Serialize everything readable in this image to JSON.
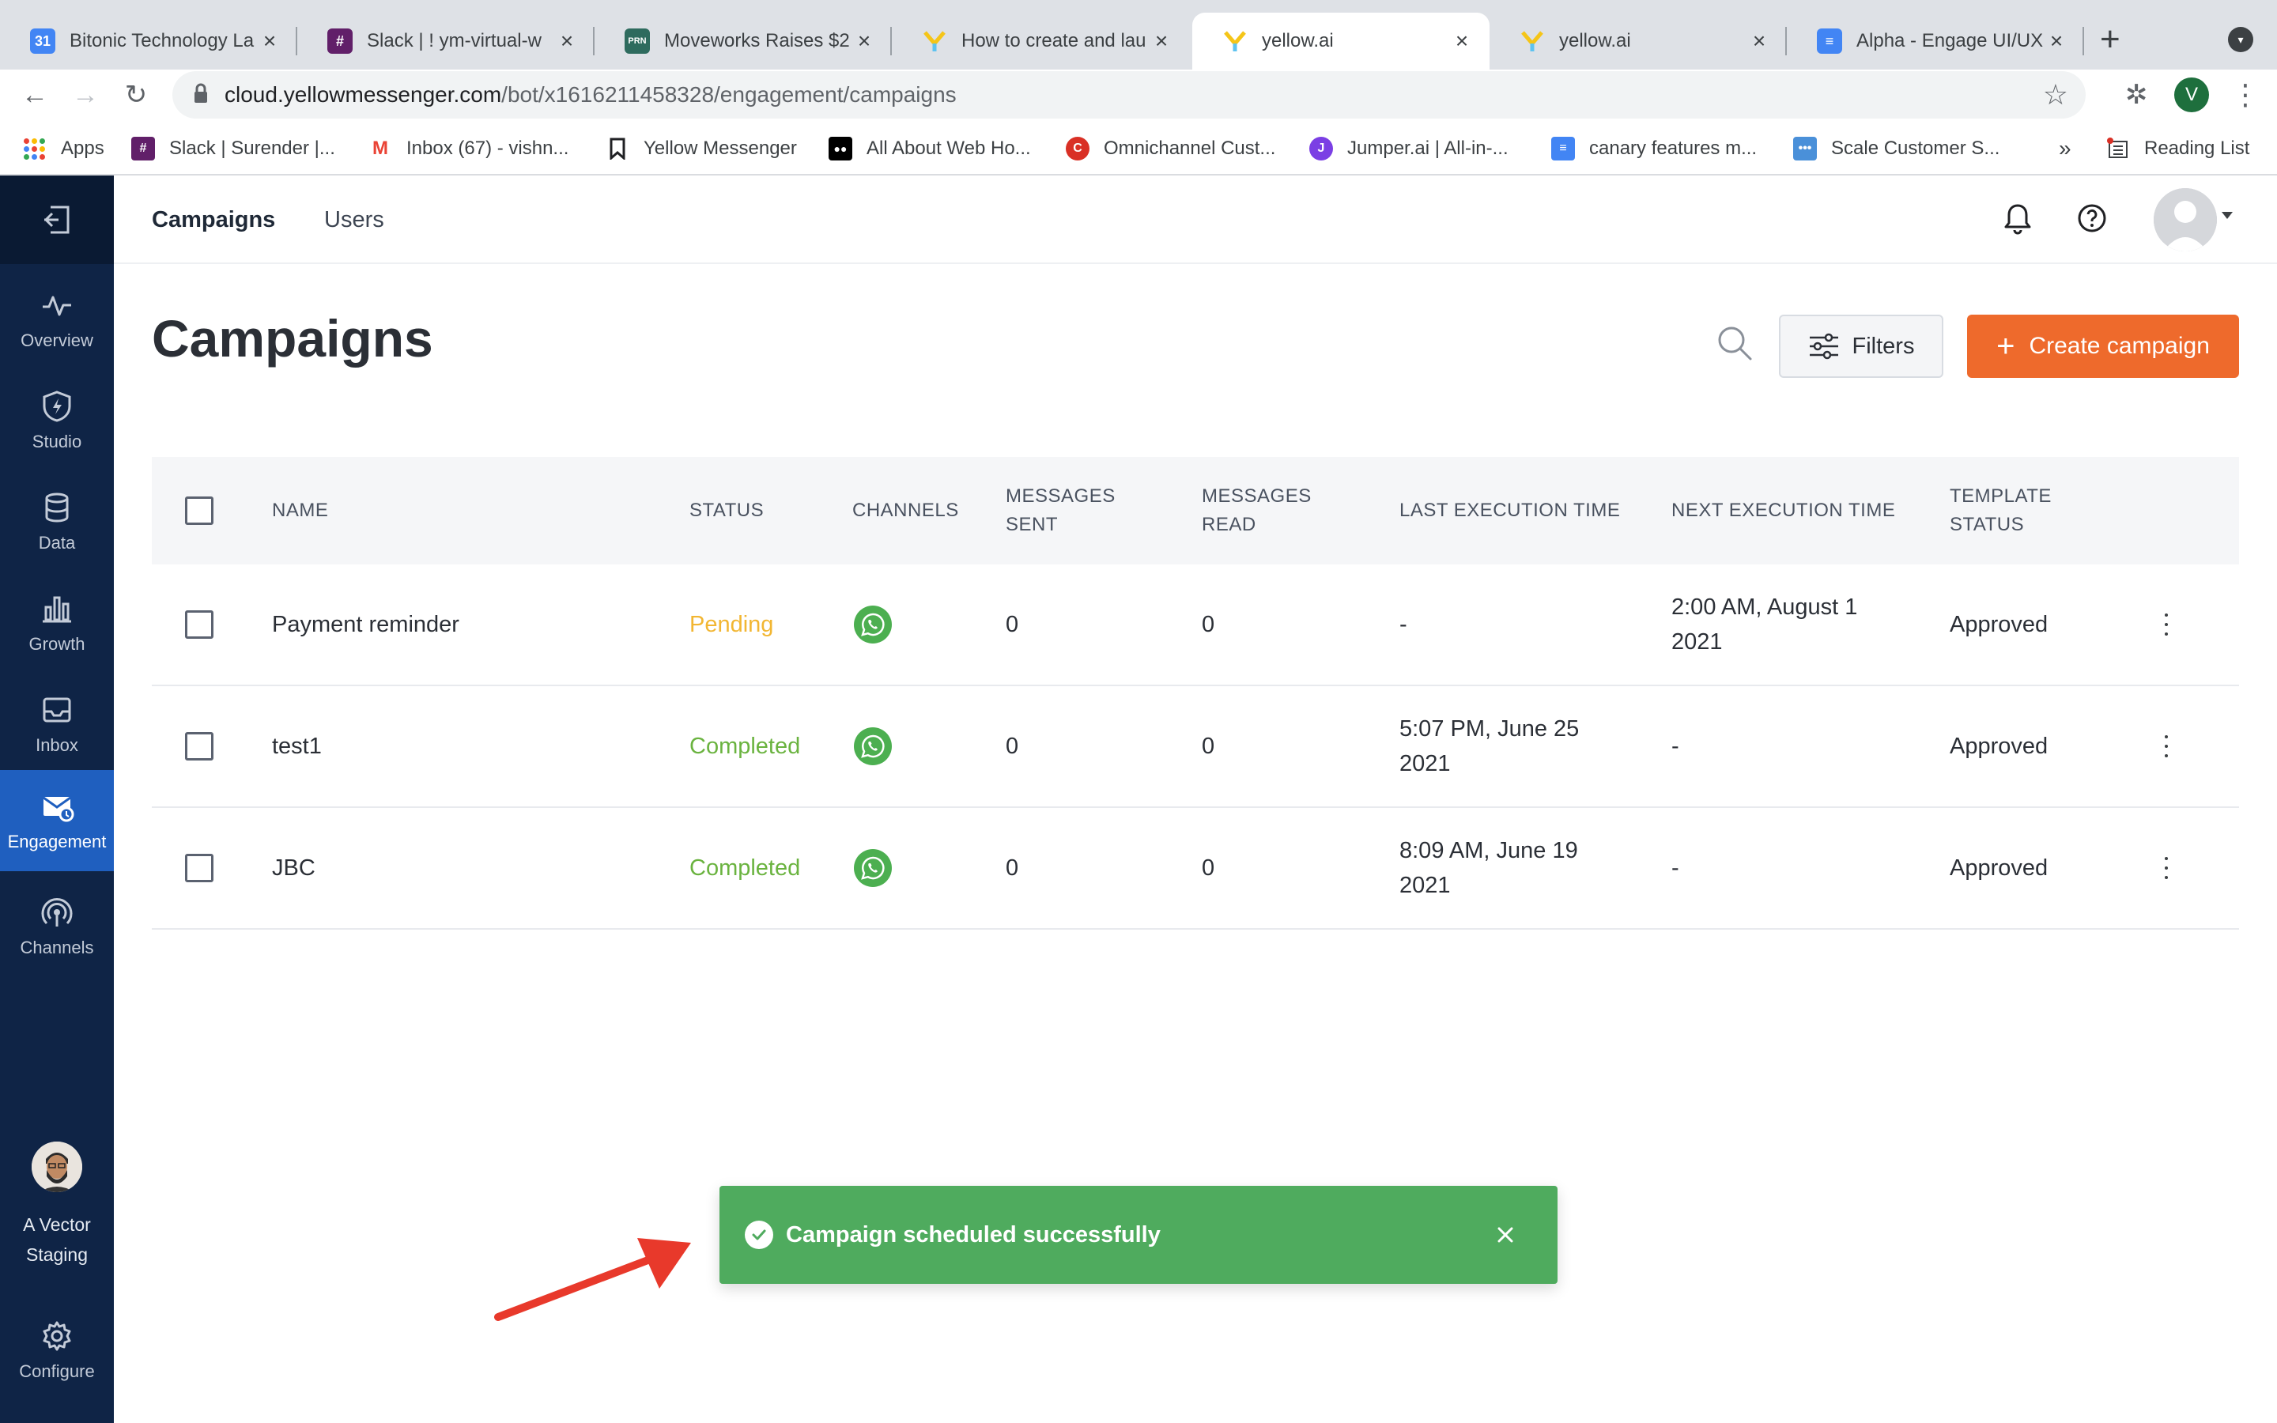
{
  "browser": {
    "tabs": [
      {
        "title": "Bitonic Technology La",
        "icon": "calendar-icon",
        "color": "#4285f4",
        "active": false
      },
      {
        "title": "Slack | ! ym-virtual-w",
        "icon": "slack-icon",
        "color": "#611f69",
        "active": false
      },
      {
        "title": "Moveworks Raises $2",
        "icon": "prn-icon",
        "color": "#2e6b5e",
        "active": false
      },
      {
        "title": "How to create and lau",
        "icon": "yellow-ai-icon",
        "color": "#f5c518",
        "active": false
      },
      {
        "title": "yellow.ai",
        "icon": "yellow-ai-icon",
        "color": "#f5c518",
        "active": true
      },
      {
        "title": "yellow.ai",
        "icon": "yellow-ai-icon",
        "color": "#f5c518",
        "active": false
      },
      {
        "title": "Alpha - Engage UI/UX",
        "icon": "docs-icon",
        "color": "#4285f4",
        "active": false
      }
    ],
    "url_host": "cloud.yellowmessenger.com",
    "url_path": "/bot/x1616211458328/engagement/campaigns",
    "profile_initial": "V",
    "bookmarks": [
      {
        "label": "Apps",
        "icon": "apps-grid-icon"
      },
      {
        "label": "Slack | Surender |...",
        "icon": "slack-icon",
        "color": "#611f69"
      },
      {
        "label": "Inbox (67) - vishn...",
        "icon": "gmail-icon",
        "color": "#ea4335"
      },
      {
        "label": "Yellow Messenger",
        "icon": "bookmark-icon",
        "color": "#202124"
      },
      {
        "label": "All About Web Ho...",
        "icon": "medium-icon",
        "color": "#000000"
      },
      {
        "label": "Omnichannel Cust...",
        "icon": "circle-logo-icon",
        "color": "#d93025"
      },
      {
        "label": "Jumper.ai | All-in-...",
        "icon": "jumper-icon",
        "color": "#7b3fe4"
      },
      {
        "label": "canary features m...",
        "icon": "docs-icon",
        "color": "#4285f4"
      },
      {
        "label": "Scale Customer S...",
        "icon": "chat-icon",
        "color": "#4a90d9"
      }
    ],
    "more_bookmarks": "»",
    "reading_list": "Reading List"
  },
  "sidebar": {
    "items": [
      {
        "label": "Overview",
        "icon": "pulse-icon",
        "active": false
      },
      {
        "label": "Studio",
        "icon": "shield-bolt-icon",
        "active": false
      },
      {
        "label": "Data",
        "icon": "database-icon",
        "active": false
      },
      {
        "label": "Growth",
        "icon": "bar-chart-icon",
        "active": false
      },
      {
        "label": "Inbox",
        "icon": "inbox-icon",
        "active": false
      },
      {
        "label": "Engagement",
        "icon": "engagement-mail-icon",
        "active": true
      },
      {
        "label": "Channels",
        "icon": "broadcast-icon",
        "active": false
      }
    ],
    "user_line1": "A Vector",
    "user_line2": "Staging",
    "configure_label": "Configure"
  },
  "header": {
    "tabs": [
      {
        "label": "Campaigns",
        "active": true
      },
      {
        "label": "Users",
        "active": false
      }
    ]
  },
  "page": {
    "title": "Campaigns",
    "filters_label": "Filters",
    "create_label": "Create campaign"
  },
  "table": {
    "columns": [
      "NAME",
      "STATUS",
      "CHANNELS",
      "MESSAGES SENT",
      "MESSAGES READ",
      "LAST EXECUTION TIME",
      "NEXT EXECUTION TIME",
      "TEMPLATE STATUS"
    ],
    "columns_wrapped": {
      "messages_sent": [
        "MESSAGES",
        "SENT"
      ],
      "messages_read": [
        "MESSAGES",
        "READ"
      ],
      "template_status": [
        "TEMPLATE",
        "STATUS"
      ]
    },
    "rows": [
      {
        "name": "Payment reminder",
        "status": "Pending",
        "channel": "whatsapp-icon",
        "sent": "0",
        "read": "0",
        "last_exec": [
          "-"
        ],
        "next_exec": [
          "2:00 AM, August 1",
          "2021"
        ],
        "template_status": "Approved"
      },
      {
        "name": "test1",
        "status": "Completed",
        "channel": "whatsapp-icon",
        "sent": "0",
        "read": "0",
        "last_exec": [
          "5:07 PM, June 25",
          "2021"
        ],
        "next_exec": [
          "-"
        ],
        "template_status": "Approved"
      },
      {
        "name": "JBC",
        "status": "Completed",
        "channel": "whatsapp-icon",
        "sent": "0",
        "read": "0",
        "last_exec": [
          "8:09 AM, June 19",
          "2021"
        ],
        "next_exec": [
          "-"
        ],
        "template_status": "Approved"
      }
    ]
  },
  "toast": {
    "message": "Campaign scheduled successfully",
    "color": "#4fab5e"
  },
  "colors": {
    "sidebar_bg": "#0f2446",
    "sidebar_active": "#1f5fbf",
    "accent_orange": "#ee6a2c",
    "pending": "#f2b632",
    "completed": "#6ab33f",
    "whatsapp": "#4caf50",
    "annotation_arrow": "#e8392b"
  }
}
